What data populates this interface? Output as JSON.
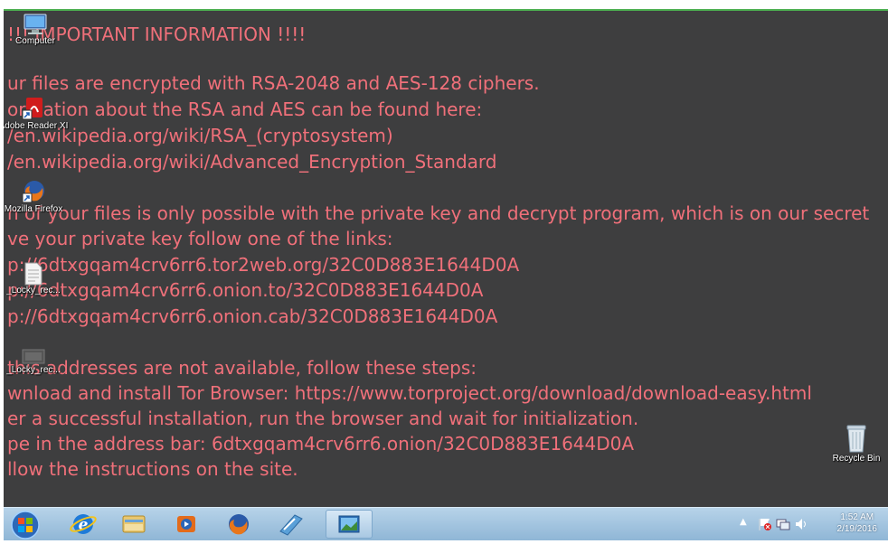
{
  "ransom_note": {
    "lines": [
      "!!! IMPORTANT INFORMATION !!!!",
      "ur files are encrypted with RSA-2048 and AES-128 ciphers.",
      "ormation about the RSA and AES can be found here:",
      "/en.wikipedia.org/wiki/RSA_(cryptosystem)",
      "/en.wikipedia.org/wiki/Advanced_Encryption_Standard",
      "",
      "n of your files is only possible with the private key and decrypt program, which is on our secret",
      "ve your private key follow one of the links:",
      "p://6dtxgqam4crv6rr6.tor2web.org/32C0D883E1644D0A",
      "p://6dtxgqam4crv6rr6.onion.to/32C0D883E1644D0A",
      "p://6dtxgqam4crv6rr6.onion.cab/32C0D883E1644D0A",
      "",
      "this addresses are not available, follow these steps:",
      "wnload and install Tor Browser: https://www.torproject.org/download/download-easy.html",
      "er a successful installation, run the browser and wait for initialization.",
      "pe in the address bar: 6dtxgqam4crv6rr6.onion/32C0D883E1644D0A",
      "llow the instructions on the site."
    ]
  },
  "desktop_icons": {
    "computer": "Computer",
    "adobe_reader": "Adobe Reader XI",
    "firefox": "Mozilla Firefox",
    "locky_rec_1": "_Locky_rec...",
    "locky_rec_2": "_Locky_rec...",
    "recycle_bin": "Recycle Bin"
  },
  "taskbar": {
    "pinned": [
      "start-orb",
      "internet-explorer-icon",
      "file-explorer-icon",
      "media-player-icon",
      "firefox-icon",
      "app-icon",
      "image-viewer-icon"
    ],
    "clock_time": "1:52 AM",
    "clock_date": "2/19/2016"
  },
  "colors": {
    "note_text": "#f0707a",
    "desktop_bg": "#3e3e3f",
    "taskbar_bg": "#9ec1df"
  }
}
